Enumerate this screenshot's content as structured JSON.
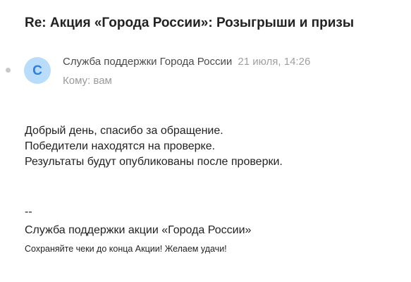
{
  "email": {
    "subject": "Re: Акция «Города России»: Розыгрыши и призы",
    "avatar_letter": "С",
    "sender_name": "Служба поддержки Города России",
    "date": "21 июля, 14:26",
    "to_label": "Кому: вам",
    "body_lines": [
      "Добрый день, спасибо за обращение.",
      "Победители находятся на проверке.",
      "Результаты будут опубликованы после проверки."
    ],
    "signature_separator": "--",
    "signature_name": "Служба поддержки акции «Города России»",
    "signature_note": "Сохраняйте чеки до конца Акции! Желаем удачи!"
  },
  "colors": {
    "avatar_bg": "#b8dcfa",
    "avatar_text": "#2f7fdc",
    "muted_text": "#a0a0a0"
  }
}
